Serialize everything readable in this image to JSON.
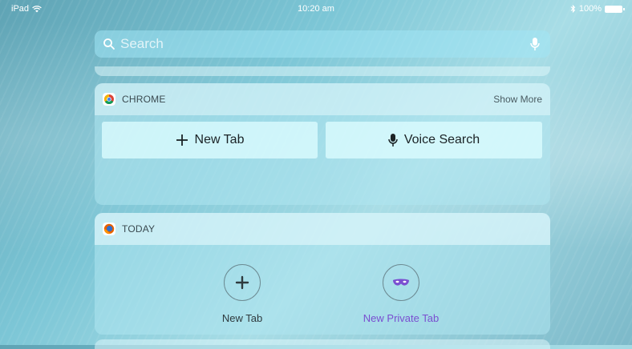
{
  "status_bar": {
    "device": "iPad",
    "time": "10:20 am",
    "battery": "100%"
  },
  "search": {
    "placeholder": "Search"
  },
  "chrome_widget": {
    "app_name": "CHROME",
    "show_more_label": "Show More",
    "new_tab_label": "New Tab",
    "voice_search_label": "Voice Search"
  },
  "today_widget": {
    "app_name": "TODAY",
    "new_tab_label": "New Tab",
    "new_private_tab_label": "New Private Tab"
  },
  "colors": {
    "private_accent": "#7a4fd0",
    "chrome_red": "#db4437",
    "firefox_orange": "#e66000"
  },
  "icons": [
    "wifi-icon",
    "bluetooth-icon",
    "battery-icon",
    "search-icon",
    "microphone-icon",
    "chrome-icon",
    "firefox-icon",
    "plus-icon",
    "mask-icon"
  ]
}
